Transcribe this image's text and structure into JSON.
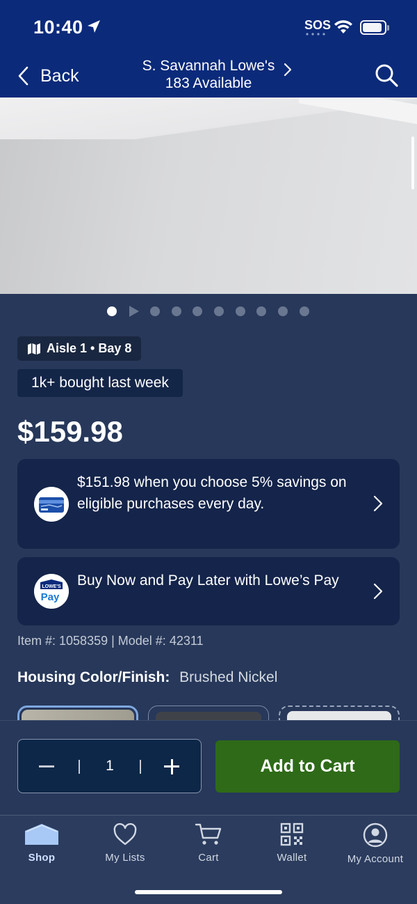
{
  "status_bar": {
    "time": "10:40",
    "sos": "SOS"
  },
  "nav": {
    "back_label": "Back",
    "store_name": "S. Savannah Lowe's",
    "availability": "183 Available"
  },
  "carousel": {
    "total_dots": 10,
    "active_index": 0,
    "video_index": 1
  },
  "product": {
    "aisle": "Aisle 1 • Bay 8",
    "bought_badge": "1k+ bought last week",
    "price": "$159.98",
    "item_model": "Item #: 1058359 | Model #: 42311",
    "housing_label": "Housing Color/Finish:",
    "housing_value": "Brushed Nickel"
  },
  "promos": [
    {
      "text": "$151.98 when you choose 5% savings on eligible purchases every day.",
      "icon": "lowes-credit-card-icon"
    },
    {
      "text": "Buy Now and Pay Later with Lowe’s Pay",
      "icon": "lowes-pay-icon",
      "logo_top": "LOWE'S",
      "logo_bottom": "Pay"
    }
  ],
  "cart": {
    "quantity": "1",
    "add_label": "Add to Cart"
  },
  "tabs": [
    {
      "label": "Shop",
      "icon": "shop-icon",
      "active": true
    },
    {
      "label": "My Lists",
      "icon": "heart-icon",
      "active": false
    },
    {
      "label": "Cart",
      "icon": "cart-icon",
      "active": false
    },
    {
      "label": "Wallet",
      "icon": "qr-code-icon",
      "active": false
    },
    {
      "label": "My Account",
      "icon": "account-icon",
      "active": false
    }
  ],
  "colors": {
    "header_blue": "#0b2a7a",
    "page_bg": "#27385a",
    "card_bg": "#14244a",
    "add_to_cart_green": "#2e6a17"
  }
}
